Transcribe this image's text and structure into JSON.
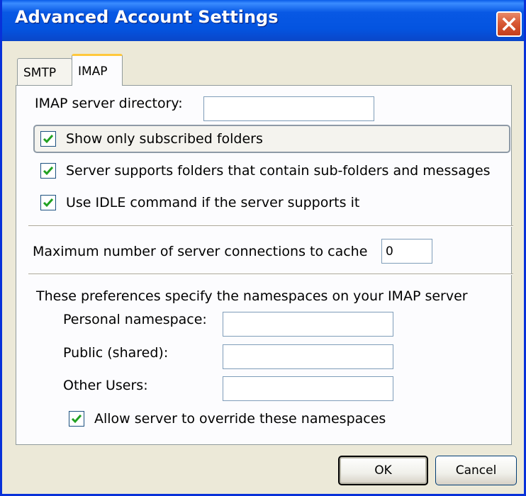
{
  "window": {
    "title": "Advanced Account Settings"
  },
  "tabs": [
    {
      "label": "SMTP",
      "active": false
    },
    {
      "label": "IMAP",
      "active": true
    }
  ],
  "imap": {
    "server_directory_label": "IMAP server directory:",
    "server_directory_value": "",
    "show_subscribed_label": "Show only subscribed folders",
    "show_subscribed_checked": true,
    "subfolders_label": "Server supports folders that contain sub-folders and messages",
    "subfolders_checked": true,
    "idle_label": "Use IDLE command if the server supports it",
    "idle_checked": true,
    "max_connections_label": "Maximum number of server connections to cache",
    "max_connections_value": "0",
    "namespaces_intro": "These preferences specify the namespaces on your IMAP server",
    "personal_label": "Personal namespace:",
    "personal_value": "",
    "public_label": "Public (shared):",
    "public_value": "",
    "other_users_label": "Other Users:",
    "other_users_value": "",
    "allow_override_label": "Allow server to override these namespaces",
    "allow_override_checked": true
  },
  "buttons": {
    "ok": "OK",
    "cancel": "Cancel"
  }
}
